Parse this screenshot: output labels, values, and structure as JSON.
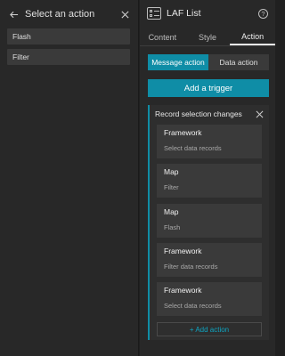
{
  "left": {
    "title": "Select an action",
    "options": [
      {
        "label": "Flash"
      },
      {
        "label": "Filter"
      }
    ]
  },
  "right": {
    "title": "LAF List",
    "help": "?",
    "tabs": [
      {
        "label": "Content"
      },
      {
        "label": "Style"
      },
      {
        "label": "Action"
      }
    ],
    "segments": [
      {
        "label": "Message action"
      },
      {
        "label": "Data action"
      }
    ],
    "add_trigger": "Add a trigger",
    "trigger": {
      "title": "Record selection changes",
      "actions": [
        {
          "name": "Framework",
          "desc": "Select data records"
        },
        {
          "name": "Map",
          "desc": "Filter"
        },
        {
          "name": "Map",
          "desc": "Flash"
        },
        {
          "name": "Framework",
          "desc": "Filter data records"
        },
        {
          "name": "Framework",
          "desc": "Select data records"
        }
      ],
      "add_action": "+ Add action"
    }
  },
  "colors": {
    "accent": "#0f8da6",
    "panel": "#282828",
    "card": "#3a3a3a"
  }
}
